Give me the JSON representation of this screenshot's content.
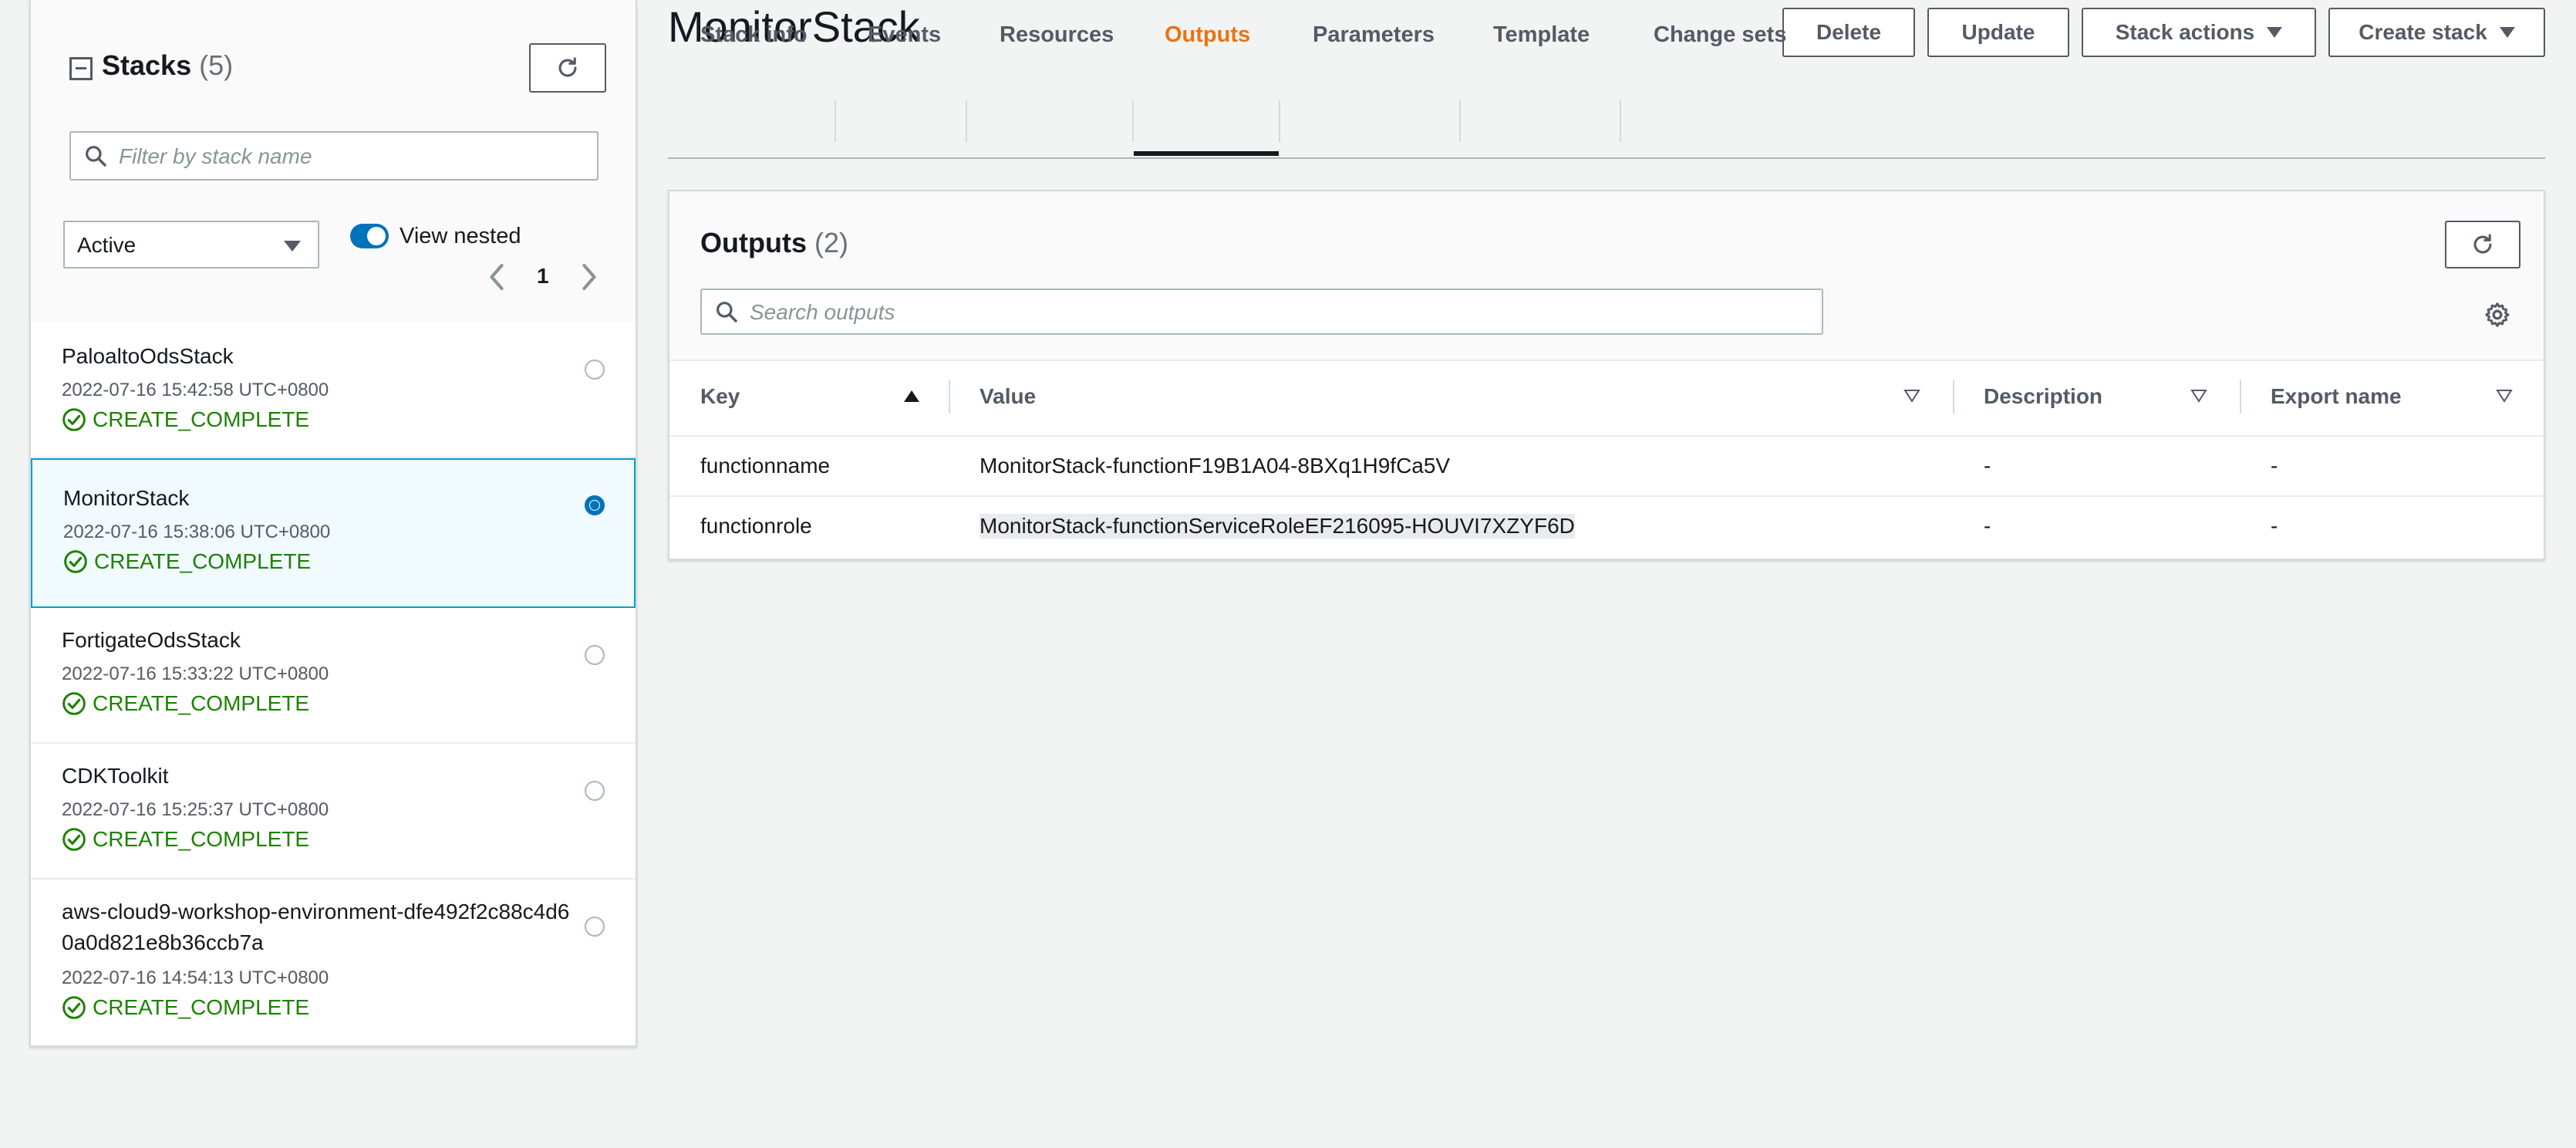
{
  "sidebar": {
    "title": "Stacks",
    "count": "(5)",
    "filter_placeholder": "Filter by stack name",
    "status_filter": "Active",
    "view_nested_label": "View nested",
    "page_number": "1",
    "stacks": [
      {
        "name": "PaloaltoOdsStack",
        "time": "2022-07-16 15:42:58 UTC+0800",
        "status": "CREATE_COMPLETE",
        "selected": false
      },
      {
        "name": "MonitorStack",
        "time": "2022-07-16 15:38:06 UTC+0800",
        "status": "CREATE_COMPLETE",
        "selected": true
      },
      {
        "name": "FortigateOdsStack",
        "time": "2022-07-16 15:33:22 UTC+0800",
        "status": "CREATE_COMPLETE",
        "selected": false
      },
      {
        "name": "CDKToolkit",
        "time": "2022-07-16 15:25:37 UTC+0800",
        "status": "CREATE_COMPLETE",
        "selected": false
      },
      {
        "name": "aws-cloud9-workshop-environment-dfe492f2c88c4d60a0d821e8b36ccb7a",
        "time": "2022-07-16 14:54:13 UTC+0800",
        "status": "CREATE_COMPLETE",
        "selected": false
      }
    ]
  },
  "header": {
    "title": "MonitorStack",
    "buttons": {
      "delete": "Delete",
      "update": "Update",
      "stack_actions": "Stack actions",
      "create_stack": "Create stack"
    }
  },
  "tabs": [
    {
      "label": "Stack info",
      "active": false
    },
    {
      "label": "Events",
      "active": false
    },
    {
      "label": "Resources",
      "active": false
    },
    {
      "label": "Outputs",
      "active": true
    },
    {
      "label": "Parameters",
      "active": false
    },
    {
      "label": "Template",
      "active": false
    },
    {
      "label": "Change sets",
      "active": false
    }
  ],
  "outputs": {
    "title": "Outputs",
    "count": "(2)",
    "search_placeholder": "Search outputs",
    "columns": [
      "Key",
      "Value",
      "Description",
      "Export name"
    ],
    "rows": [
      {
        "key": "functionname",
        "value": "MonitorStack-functionF19B1A04-8BXq1H9fCa5V",
        "description": "-",
        "export_name": "-"
      },
      {
        "key": "functionrole",
        "value": "MonitorStack-functionServiceRoleEF216095-HOUVI7XZYF6D",
        "description": "-",
        "export_name": "-"
      }
    ]
  },
  "colors": {
    "accent_orange": "#ec7211",
    "success_green": "#1d8102",
    "selection_blue": "#0073bb",
    "selected_bg": "#f1faff"
  }
}
